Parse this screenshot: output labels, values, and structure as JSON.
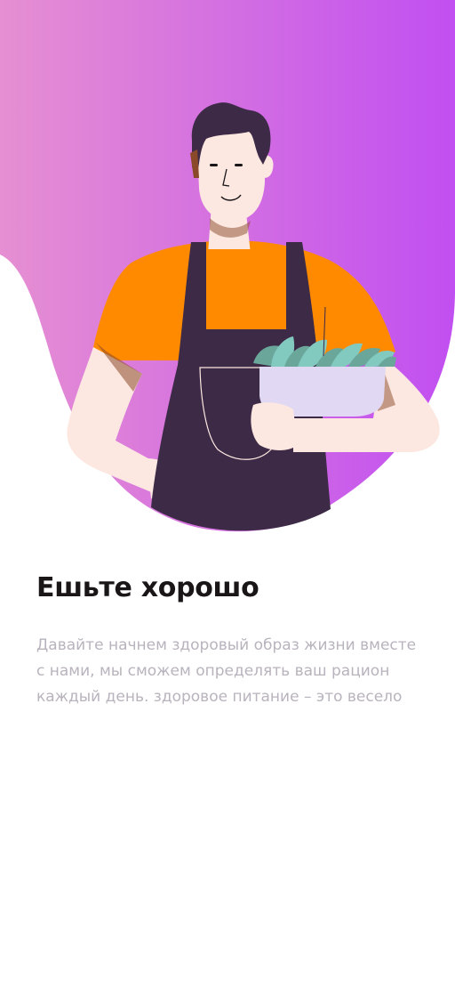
{
  "onboarding": {
    "title": "Ешьте хорошо",
    "description": "Давайте начнем здоровый образ жизни вместе с нами, мы сможем определять ваш рацион каждый день. здоровое питание – это весело"
  },
  "colors": {
    "gradient_start": "#e68fd2",
    "gradient_end": "#c14ff1",
    "shirt": "#ff8a00",
    "apron": "#3d2a47",
    "skin": "#fde8e1",
    "bowl": "#e1d9f4",
    "leaves": "#82c9c0"
  },
  "illustration": {
    "icon": "chef-holding-salad-bowl-icon"
  }
}
